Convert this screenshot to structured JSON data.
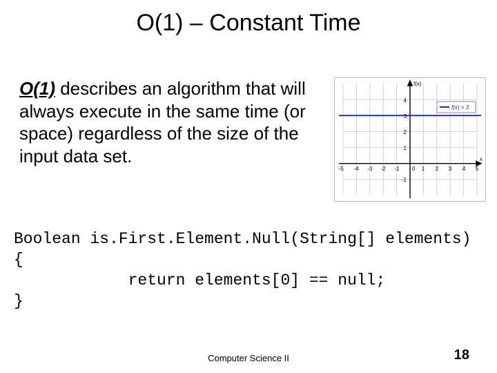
{
  "title": "O(1) – Constant Time",
  "desc_lead": "O(1)",
  "desc_rest": " describes an algorithm that will always execute in the same time (or space) regardless of the size of the input data set.",
  "code_l1": "Boolean is.First.Element.Null(String[] elements)",
  "code_l2": "{",
  "code_l3": "            return elements[0] == null;",
  "code_l4": "}",
  "footer_center": "Computer Science II",
  "footer_right": "18",
  "chart_data": {
    "type": "line",
    "title": "",
    "xlabel": "x",
    "ylabel": "f(x)",
    "xlim": [
      -5,
      5
    ],
    "ylim": [
      -2,
      5
    ],
    "x_ticks": [
      -5,
      -4,
      -3,
      -2,
      -1,
      0,
      1,
      2,
      3,
      4,
      5
    ],
    "y_ticks": [
      -1,
      0,
      1,
      2,
      3,
      4
    ],
    "series": [
      {
        "name": "f(x) = 3",
        "x": [
          -5,
          5
        ],
        "values": [
          3,
          3
        ]
      }
    ],
    "legend_position": "upper-right",
    "grid": true
  }
}
